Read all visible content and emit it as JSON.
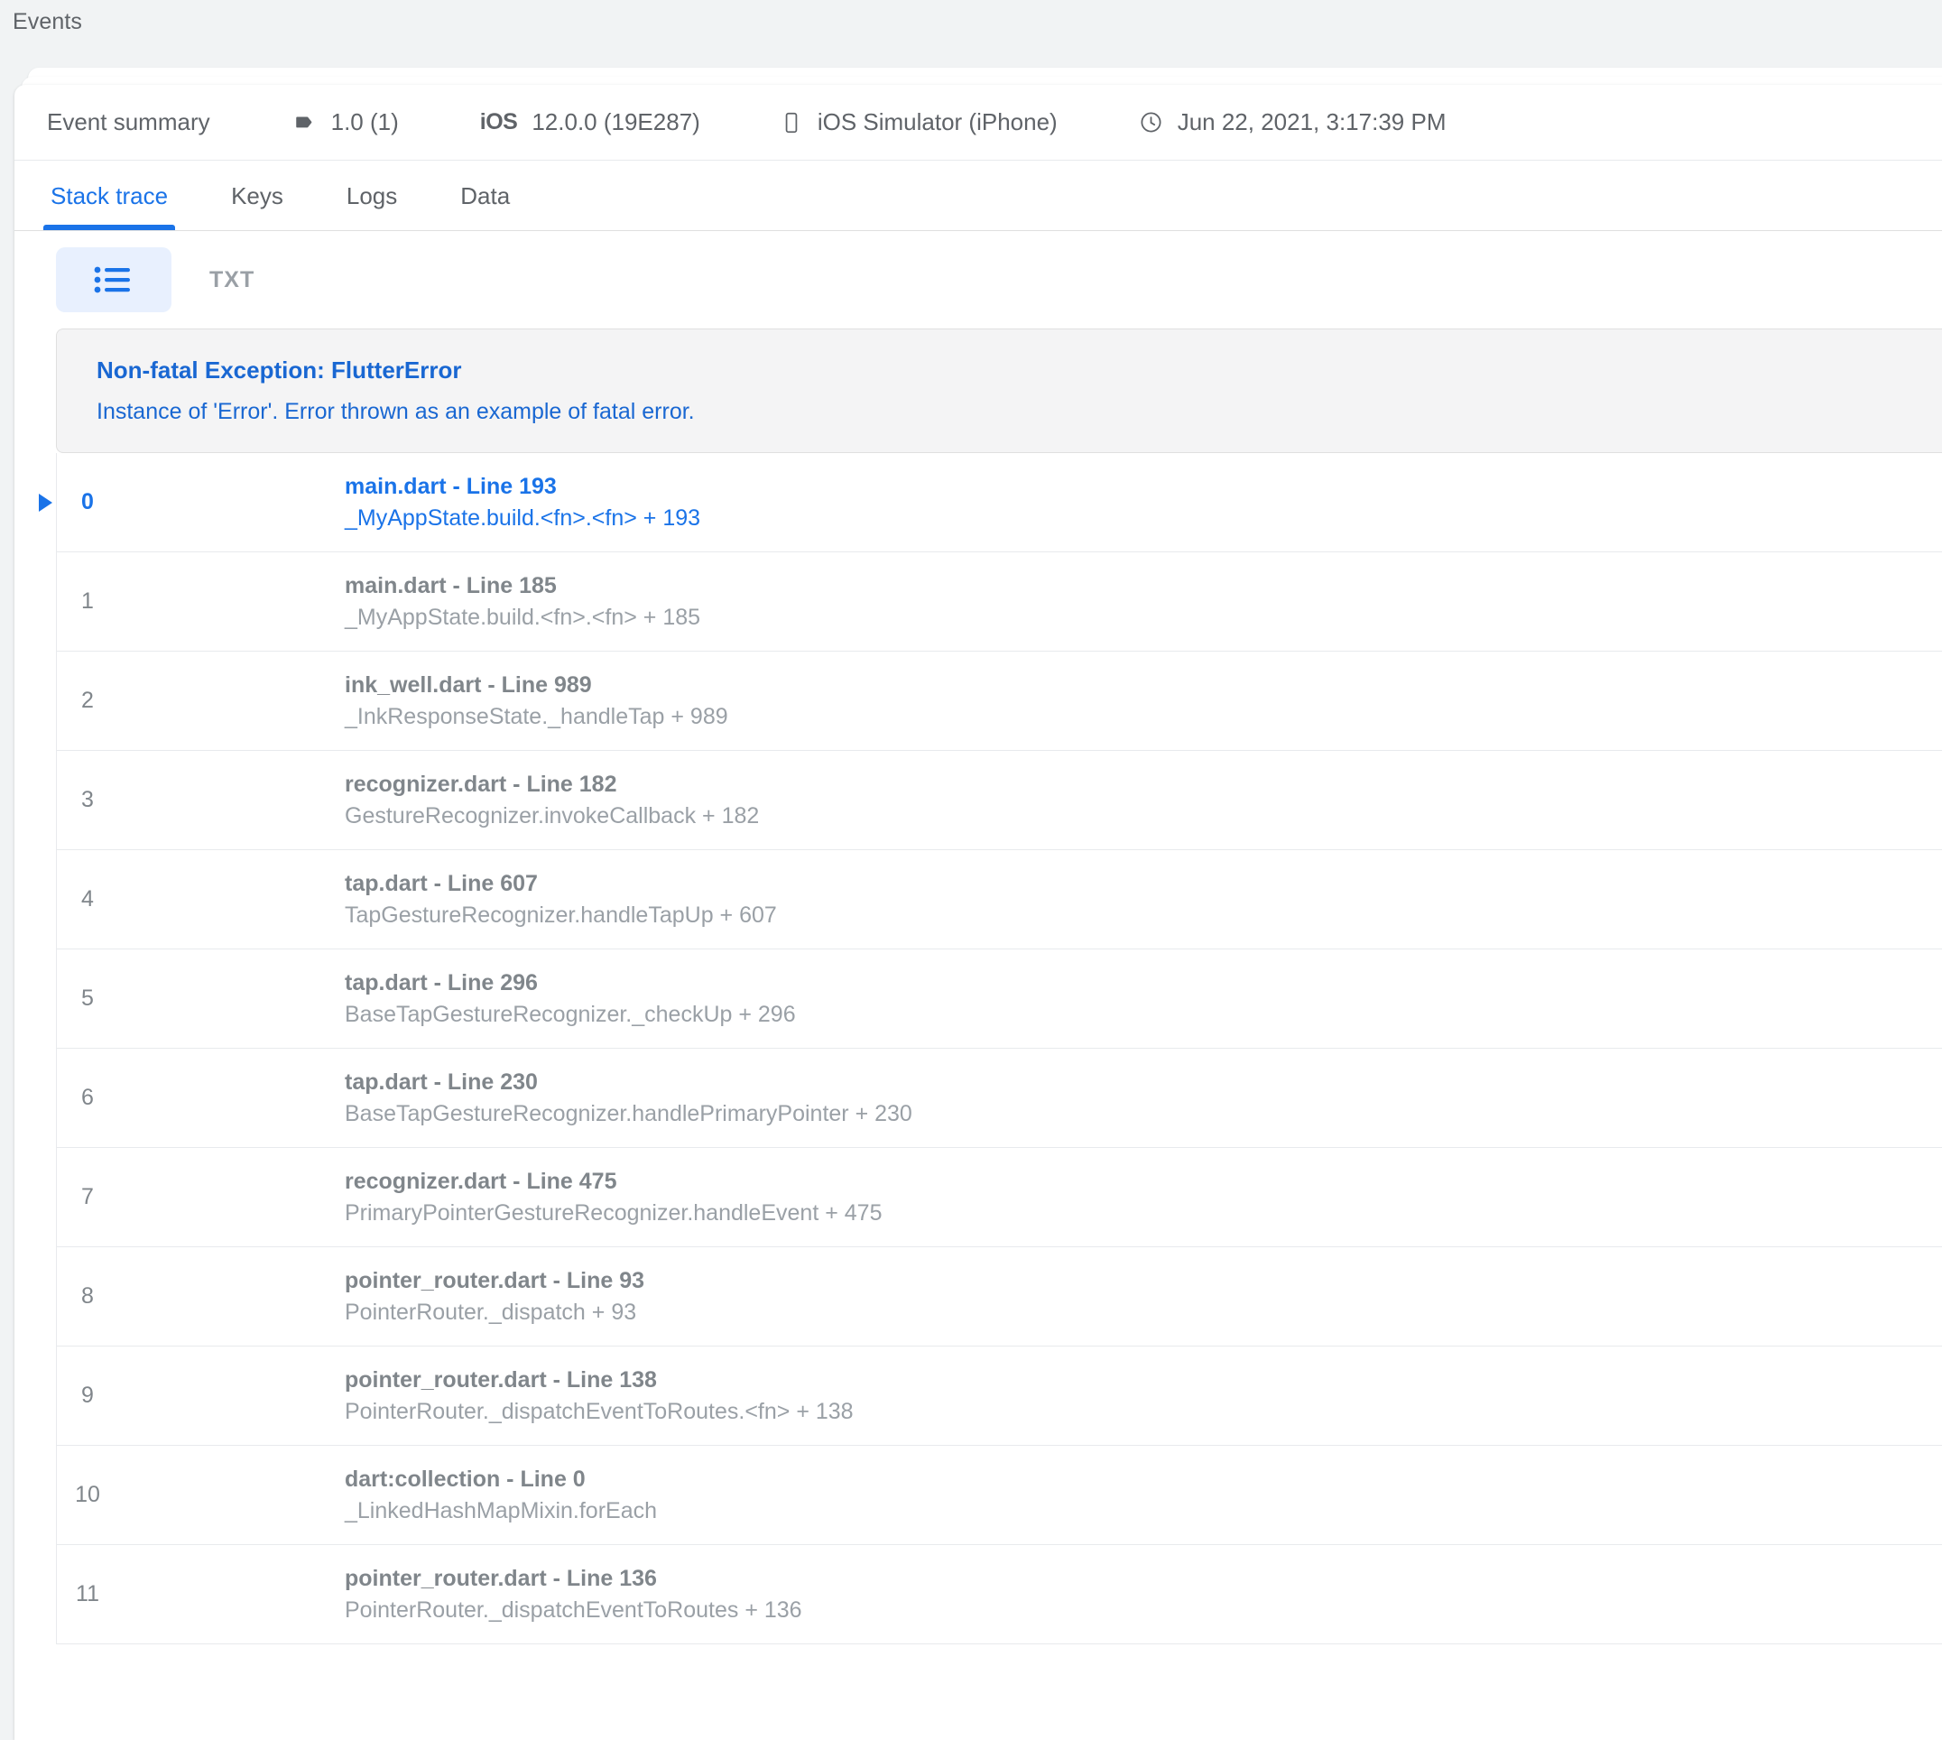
{
  "breadcrumb": {
    "label": "Events"
  },
  "summary": {
    "title": "Event summary",
    "version": "1.0 (1)",
    "os_label": "iOS",
    "os_version": "12.0.0 (19E287)",
    "device": "iOS Simulator (iPhone)",
    "timestamp": "Jun 22, 2021, 3:17:39 PM",
    "icons": {
      "version": "tag-icon",
      "os": "ios-icon",
      "device": "phone-icon",
      "time": "clock-icon"
    }
  },
  "tabs": [
    {
      "label": "Stack trace",
      "active": true
    },
    {
      "label": "Keys",
      "active": false
    },
    {
      "label": "Logs",
      "active": false
    },
    {
      "label": "Data",
      "active": false
    }
  ],
  "toolbar": {
    "list_view_icon": "list-view-icon",
    "txt_label": "TXT"
  },
  "exception": {
    "title": "Non-fatal Exception: FlutterError",
    "subtitle": "Instance of 'Error'. Error thrown as an example of fatal error."
  },
  "frames": [
    {
      "index": "0",
      "file": "main.dart - Line 193",
      "symbol": "_MyAppState.build.<fn>.<fn> + 193",
      "active": true
    },
    {
      "index": "1",
      "file": "main.dart - Line 185",
      "symbol": "_MyAppState.build.<fn>.<fn> + 185",
      "active": false
    },
    {
      "index": "2",
      "file": "ink_well.dart - Line 989",
      "symbol": "_InkResponseState._handleTap + 989",
      "active": false
    },
    {
      "index": "3",
      "file": "recognizer.dart - Line 182",
      "symbol": "GestureRecognizer.invokeCallback + 182",
      "active": false
    },
    {
      "index": "4",
      "file": "tap.dart - Line 607",
      "symbol": "TapGestureRecognizer.handleTapUp + 607",
      "active": false
    },
    {
      "index": "5",
      "file": "tap.dart - Line 296",
      "symbol": "BaseTapGestureRecognizer._checkUp + 296",
      "active": false
    },
    {
      "index": "6",
      "file": "tap.dart - Line 230",
      "symbol": "BaseTapGestureRecognizer.handlePrimaryPointer + 230",
      "active": false
    },
    {
      "index": "7",
      "file": "recognizer.dart - Line 475",
      "symbol": "PrimaryPointerGestureRecognizer.handleEvent + 475",
      "active": false
    },
    {
      "index": "8",
      "file": "pointer_router.dart - Line 93",
      "symbol": "PointerRouter._dispatch + 93",
      "active": false
    },
    {
      "index": "9",
      "file": "pointer_router.dart - Line 138",
      "symbol": "PointerRouter._dispatchEventToRoutes.<fn> + 138",
      "active": false
    },
    {
      "index": "10",
      "file": "dart:collection - Line 0",
      "symbol": "_LinkedHashMapMixin.forEach",
      "active": false
    },
    {
      "index": "11",
      "file": "pointer_router.dart - Line 136",
      "symbol": "PointerRouter._dispatchEventToRoutes + 136",
      "active": false
    }
  ],
  "colors": {
    "accent": "#1a73e8",
    "link": "#1967d2",
    "text_muted": "#5f6368",
    "text_light": "#9aa0a6",
    "page_bg": "#f1f3f4",
    "banner_bg": "#f4f4f5",
    "toggle_bg": "#e8f0fe"
  }
}
